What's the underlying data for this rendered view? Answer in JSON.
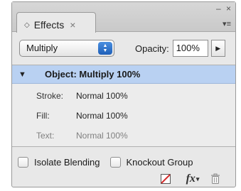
{
  "window": {
    "controls": "– ×"
  },
  "tab": {
    "icon": "diamond-icon",
    "title": "Effects",
    "close": "×"
  },
  "panel_menu": {
    "icon": "panel-menu-icon",
    "glyph": "▾≡"
  },
  "blend_mode": {
    "value": "Multiply",
    "options_visible": [
      "Multiply"
    ]
  },
  "opacity": {
    "label": "Opacity:",
    "value": "100%"
  },
  "list": {
    "object": {
      "label": "Object: Multiply 100%",
      "selected": true
    },
    "rows": [
      {
        "name": "Stroke:",
        "value": "Normal 100%",
        "dimmed": false
      },
      {
        "name": "Fill:",
        "value": "Normal 100%",
        "dimmed": false
      },
      {
        "name": "Text:",
        "value": "Normal 100%",
        "dimmed": true
      }
    ]
  },
  "options": {
    "isolate_blending": {
      "label": "Isolate Blending",
      "checked": false
    },
    "knockout_group": {
      "label": "Knockout Group",
      "checked": false
    }
  },
  "footer": {
    "clear_icon": "clear-effects-icon",
    "fx_label": "fx",
    "fx_icon": "fx-icon",
    "trash_icon": "trash-icon"
  },
  "colors": {
    "selection": "#b9d1f2",
    "select_stepper": "#2a6fcf",
    "clear_red": "#d42b2b"
  }
}
